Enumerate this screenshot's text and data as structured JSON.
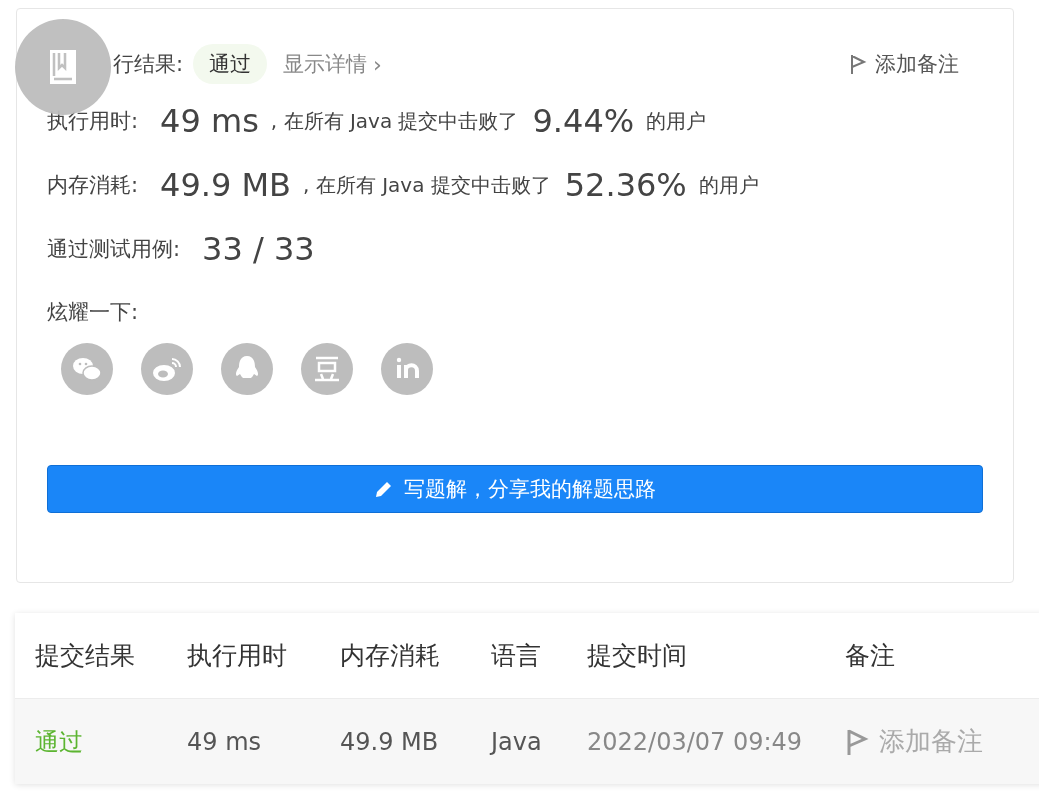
{
  "result": {
    "label": "行结果:",
    "status": "通过",
    "details_link": "显示详情",
    "chevron": "›",
    "add_note": "添加备注"
  },
  "stats": [
    {
      "label": "执行用时:",
      "value": "49 ms",
      "text_before": ", 在所有 Java 提交中击败了",
      "percent": "9.44%",
      "text_after": "的用户"
    },
    {
      "label": "内存消耗:",
      "value": "49.9 MB",
      "text_before": ", 在所有 Java 提交中击败了",
      "percent": "52.36%",
      "text_after": "的用户"
    }
  ],
  "tests": {
    "label": "通过测试用例:",
    "value": "33 / 33"
  },
  "share": {
    "label": "炫耀一下:"
  },
  "write_button": "写题解，分享我的解题思路",
  "table": {
    "columns": [
      "提交结果",
      "执行用时",
      "内存消耗",
      "语言",
      "提交时间",
      "备注"
    ],
    "rows": [
      {
        "result": "通过",
        "runtime": "49 ms",
        "memory": "49.9 MB",
        "language": "Java",
        "time": "2022/03/07 09:49",
        "note": "添加备注"
      }
    ]
  }
}
